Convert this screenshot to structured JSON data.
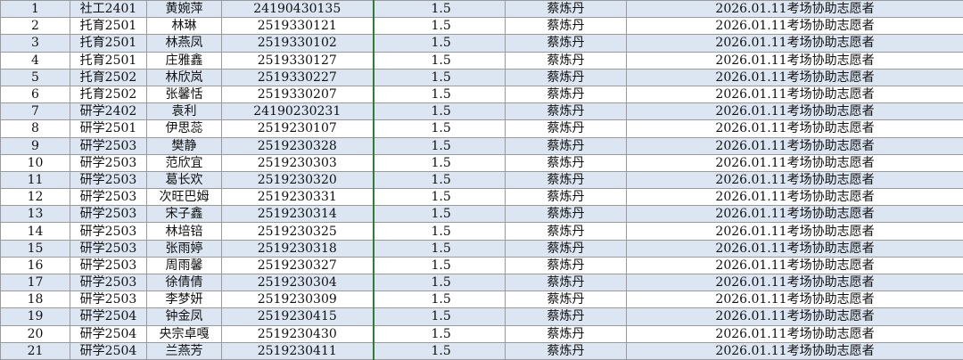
{
  "table": {
    "rows": [
      {
        "no": "1",
        "class": "社工2401",
        "name": "黄婉萍",
        "id": "24190430135",
        "hours": "1.5",
        "supervisor": "蔡炼丹",
        "activity": "2026.01.11考场协助志愿者"
      },
      {
        "no": "2",
        "class": "托育2501",
        "name": "林琳",
        "id": "2519330121",
        "hours": "1.5",
        "supervisor": "蔡炼丹",
        "activity": "2026.01.11考场协助志愿者"
      },
      {
        "no": "3",
        "class": "托育2501",
        "name": "林燕凤",
        "id": "2519330102",
        "hours": "1.5",
        "supervisor": "蔡炼丹",
        "activity": "2026.01.11考场协助志愿者"
      },
      {
        "no": "4",
        "class": "托育2501",
        "name": "庄雅鑫",
        "id": "2519330127",
        "hours": "1.5",
        "supervisor": "蔡炼丹",
        "activity": "2026.01.11考场协助志愿者"
      },
      {
        "no": "5",
        "class": "托育2502",
        "name": "林欣岚",
        "id": "2519330227",
        "hours": "1.5",
        "supervisor": "蔡炼丹",
        "activity": "2026.01.11考场协助志愿者"
      },
      {
        "no": "6",
        "class": "托育2502",
        "name": "张馨恬",
        "id": "2519330207",
        "hours": "1.5",
        "supervisor": "蔡炼丹",
        "activity": "2026.01.11考场协助志愿者"
      },
      {
        "no": "7",
        "class": "研学2402",
        "name": "袁利",
        "id": "24190230231",
        "hours": "1.5",
        "supervisor": "蔡炼丹",
        "activity": "2026.01.11考场协助志愿者"
      },
      {
        "no": "8",
        "class": "研学2501",
        "name": "伊思蕊",
        "id": "2519230107",
        "hours": "1.5",
        "supervisor": "蔡炼丹",
        "activity": "2026.01.11考场协助志愿者"
      },
      {
        "no": "9",
        "class": "研学2503",
        "name": "樊静",
        "id": "2519230328",
        "hours": "1.5",
        "supervisor": "蔡炼丹",
        "activity": "2026.01.11考场协助志愿者"
      },
      {
        "no": "10",
        "class": "研学2503",
        "name": "范欣宜",
        "id": "2519230303",
        "hours": "1.5",
        "supervisor": "蔡炼丹",
        "activity": "2026.01.11考场协助志愿者"
      },
      {
        "no": "11",
        "class": "研学2503",
        "name": "葛长欢",
        "id": "2519230320",
        "hours": "1.5",
        "supervisor": "蔡炼丹",
        "activity": "2026.01.11考场协助志愿者"
      },
      {
        "no": "12",
        "class": "研学2503",
        "name": "次旺巴姆",
        "id": "2519230331",
        "hours": "1.5",
        "supervisor": "蔡炼丹",
        "activity": "2026.01.11考场协助志愿者"
      },
      {
        "no": "13",
        "class": "研学2503",
        "name": "宋子鑫",
        "id": "2519230314",
        "hours": "1.5",
        "supervisor": "蔡炼丹",
        "activity": "2026.01.11考场协助志愿者"
      },
      {
        "no": "14",
        "class": "研学2503",
        "name": "林培锫",
        "id": "2519230325",
        "hours": "1.5",
        "supervisor": "蔡炼丹",
        "activity": "2026.01.11考场协助志愿者"
      },
      {
        "no": "15",
        "class": "研学2503",
        "name": "张雨婷",
        "id": "2519230318",
        "hours": "1.5",
        "supervisor": "蔡炼丹",
        "activity": "2026.01.11考场协助志愿者"
      },
      {
        "no": "16",
        "class": "研学2503",
        "name": "周雨馨",
        "id": "2519230327",
        "hours": "1.5",
        "supervisor": "蔡炼丹",
        "activity": "2026.01.11考场协助志愿者"
      },
      {
        "no": "17",
        "class": "研学2503",
        "name": "徐倩倩",
        "id": "2519230304",
        "hours": "1.5",
        "supervisor": "蔡炼丹",
        "activity": "2026.01.11考场协助志愿者"
      },
      {
        "no": "18",
        "class": "研学2503",
        "name": "李梦妍",
        "id": "2519230309",
        "hours": "1.5",
        "supervisor": "蔡炼丹",
        "activity": "2026.01.11考场协助志愿者"
      },
      {
        "no": "19",
        "class": "研学2504",
        "name": "钟金凤",
        "id": "2519230415",
        "hours": "1.5",
        "supervisor": "蔡炼丹",
        "activity": "2026.01.11考场协助志愿者"
      },
      {
        "no": "20",
        "class": "研学2504",
        "name": "央宗卓嘎",
        "id": "2519230430",
        "hours": "1.5",
        "supervisor": "蔡炼丹",
        "activity": "2026.01.11考场协助志愿者"
      },
      {
        "no": "21",
        "class": "研学2504",
        "name": "兰燕芳",
        "id": "2519230411",
        "hours": "1.5",
        "supervisor": "蔡炼丹",
        "activity": "2026.01.11考场协助志愿者"
      }
    ]
  },
  "colors": {
    "row_shade": "#dce6f2",
    "grid_line": "#9a9a9a",
    "marker_line": "#2e7d32"
  }
}
